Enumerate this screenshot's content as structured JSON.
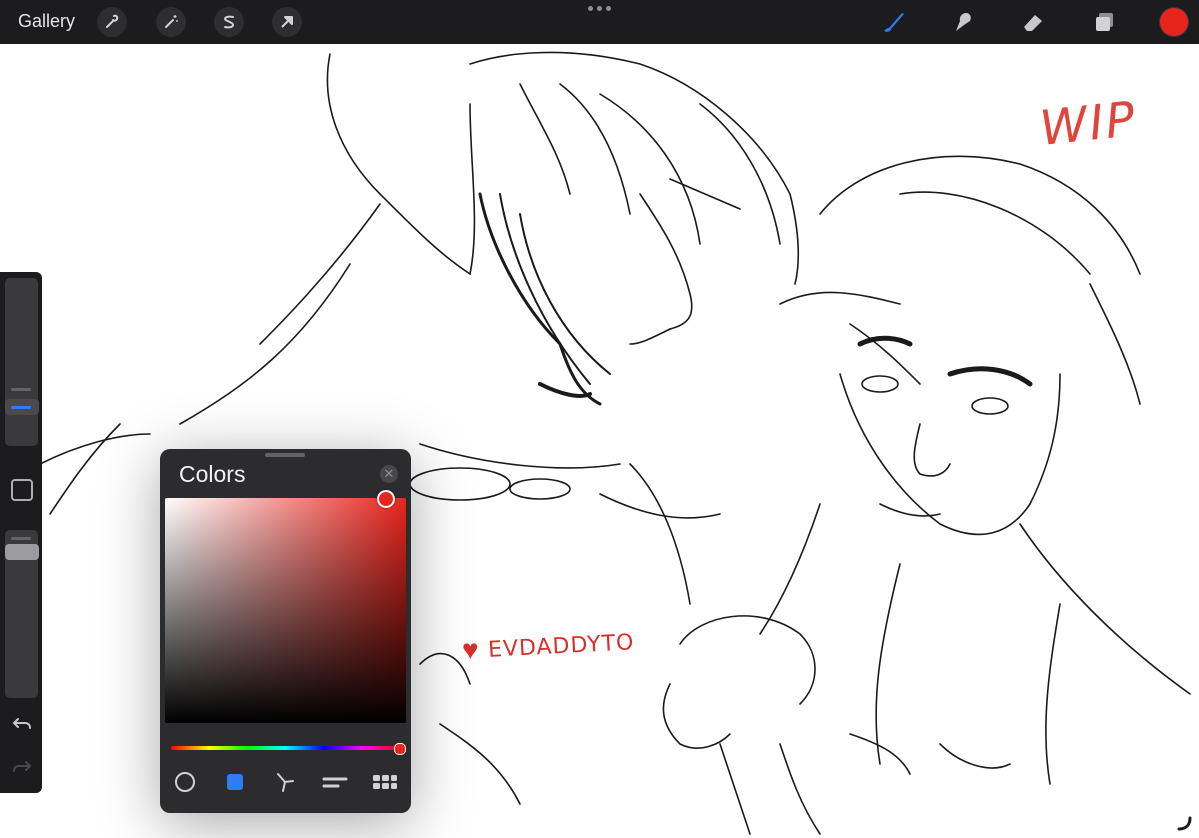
{
  "topbar": {
    "gallery_label": "Gallery",
    "left_tools": [
      "wrench-icon",
      "magic-wand-icon",
      "selection-icon",
      "transform-arrow-icon"
    ],
    "right_tools": [
      "brush-icon",
      "smudge-icon",
      "eraser-icon",
      "layers-icon"
    ],
    "active_tool": "brush-icon",
    "current_color": "#e8251d",
    "accent": "#2f7cf6"
  },
  "canvas": {
    "wip_text": "WIP",
    "signature_text": "EVDADDYTO"
  },
  "sidebar": {
    "brush_size": 0.27,
    "opacity": 0.88
  },
  "colors_panel": {
    "title": "Colors",
    "selected_color": "#e8251d",
    "hue_position": 1.0,
    "modes": [
      "disc-icon",
      "classic-icon",
      "harmony-icon",
      "value-icon",
      "palettes-icon"
    ],
    "active_mode": "classic-icon"
  }
}
